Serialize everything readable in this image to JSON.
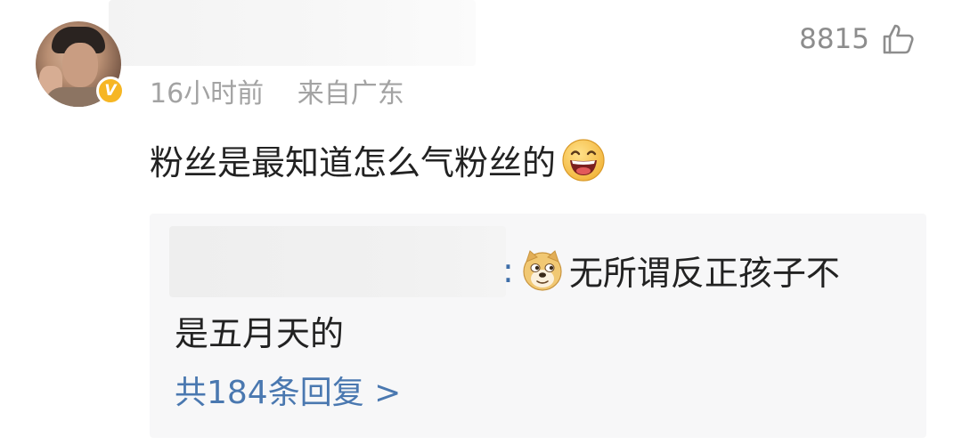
{
  "comment": {
    "likes_count": "8815",
    "time": "16小时前",
    "location": "来自广东",
    "text": "粉丝是最知道怎么气粉丝的",
    "emoji": "laughing-emoji"
  },
  "reply": {
    "colon": ":",
    "line1": "无所谓反正孩子不",
    "line2": "是五月天的",
    "emoji": "doge-emoji",
    "more_label": "共184条回复 >"
  },
  "colors": {
    "meta_gray": "#a3a3a3",
    "link_blue": "#4a78b0",
    "badge_gold": "#f6b623",
    "reply_bg": "#f7f7f8"
  }
}
